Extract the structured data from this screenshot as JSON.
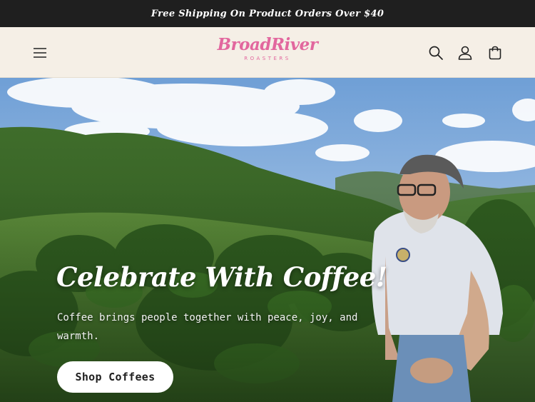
{
  "announcement": {
    "text": "Free Shipping On Product Orders Over $40"
  },
  "header": {
    "logo": {
      "name": "BroadRiver",
      "tagline": "ROASTERS"
    },
    "icons": {
      "menu": "menu-icon",
      "search": "search-icon",
      "account": "account-icon",
      "cart": "cart-icon"
    }
  },
  "hero": {
    "title": "Celebrate With Coffee!",
    "text": "Coffee brings people together with peace, joy, and warmth.",
    "cta_label": "Shop Coffees"
  },
  "colors": {
    "announcement_bg": "#1f1f1f",
    "header_bg": "#f5efe6",
    "logo_pink": "#e2679e",
    "button_bg": "#ffffff"
  }
}
